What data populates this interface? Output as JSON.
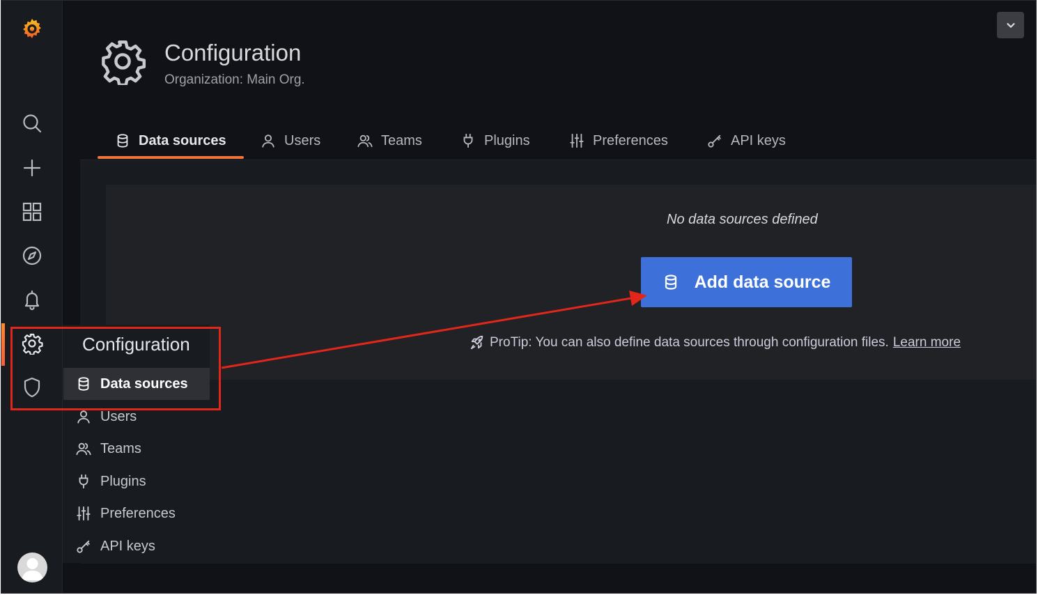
{
  "header": {
    "title": "Configuration",
    "subtitle": "Organization: Main Org."
  },
  "tabs": [
    {
      "label": "Data sources",
      "icon": "database-icon",
      "active": true
    },
    {
      "label": "Users",
      "icon": "user-icon"
    },
    {
      "label": "Teams",
      "icon": "users-icon"
    },
    {
      "label": "Plugins",
      "icon": "plug-icon"
    },
    {
      "label": "Preferences",
      "icon": "sliders-icon"
    },
    {
      "label": "API keys",
      "icon": "key-icon"
    }
  ],
  "main": {
    "empty_text": "No data sources defined",
    "add_button": "Add data source",
    "protip": "ProTip: You can also define data sources through configuration files.",
    "learn_more": "Learn more"
  },
  "sidebar": {
    "icons": [
      "grafana-logo-icon",
      "search-icon",
      "plus-icon",
      "dashboards-icon",
      "explore-icon",
      "alerting-icon",
      "gear-icon",
      "shield-icon"
    ]
  },
  "flyout": {
    "header": "Configuration",
    "items": [
      {
        "label": "Data sources",
        "active": true
      },
      {
        "label": "Users"
      },
      {
        "label": "Teams"
      },
      {
        "label": "Plugins"
      },
      {
        "label": "Preferences"
      },
      {
        "label": "API keys"
      }
    ]
  },
  "colors": {
    "accent": "#f0753d",
    "primary_button": "#3d71d9",
    "annotation": "#e1261c",
    "background": "#111217"
  }
}
